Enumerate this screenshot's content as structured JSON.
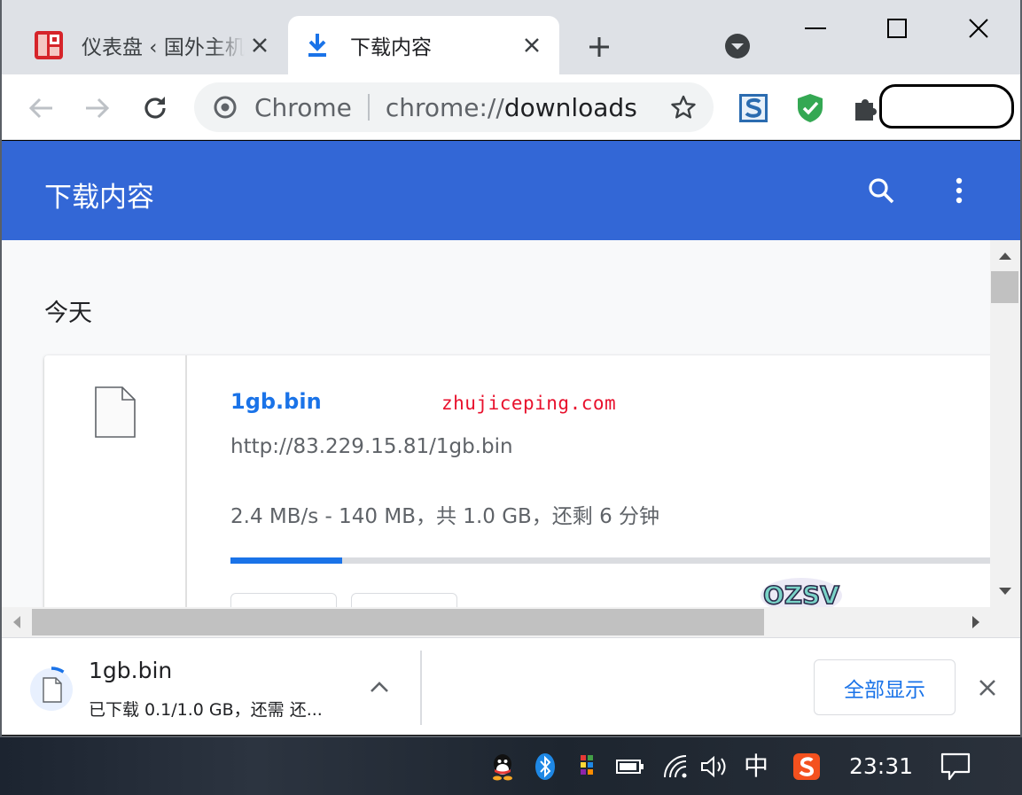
{
  "tabs": [
    {
      "title": "仪表盘 ‹ 国外主机",
      "icon": "site-favicon-icon",
      "active": false
    },
    {
      "title": "下载内容",
      "icon": "download-icon",
      "active": true
    }
  ],
  "omnibox": {
    "scheme_label": "Chrome",
    "url_scheme": "chrome://",
    "url_host": "downloads"
  },
  "page": {
    "title": "下载内容",
    "date_heading": "今天"
  },
  "download_item": {
    "file_name": "1gb.bin",
    "url": "http://83.229.15.81/1gb.bin",
    "status": "2.4 MB/s - 140 MB，共 1.0 GB，还剩 6 分钟",
    "progress_fraction": 0.14
  },
  "shelf": {
    "file_name": "1gb.bin",
    "status": "已下载 0.1/1.0 GB，还需 还...",
    "show_all_label": "全部显示"
  },
  "watermark": {
    "text": "zhujiceping.com",
    "logo_text": "OZSV"
  },
  "taskbar": {
    "ime_label": "中",
    "clock": "23:31"
  },
  "colors": {
    "accent": "#1a73e8",
    "header": "#3367d6",
    "tabstrip": "#dee1e6",
    "watermark": "#e8112d"
  }
}
